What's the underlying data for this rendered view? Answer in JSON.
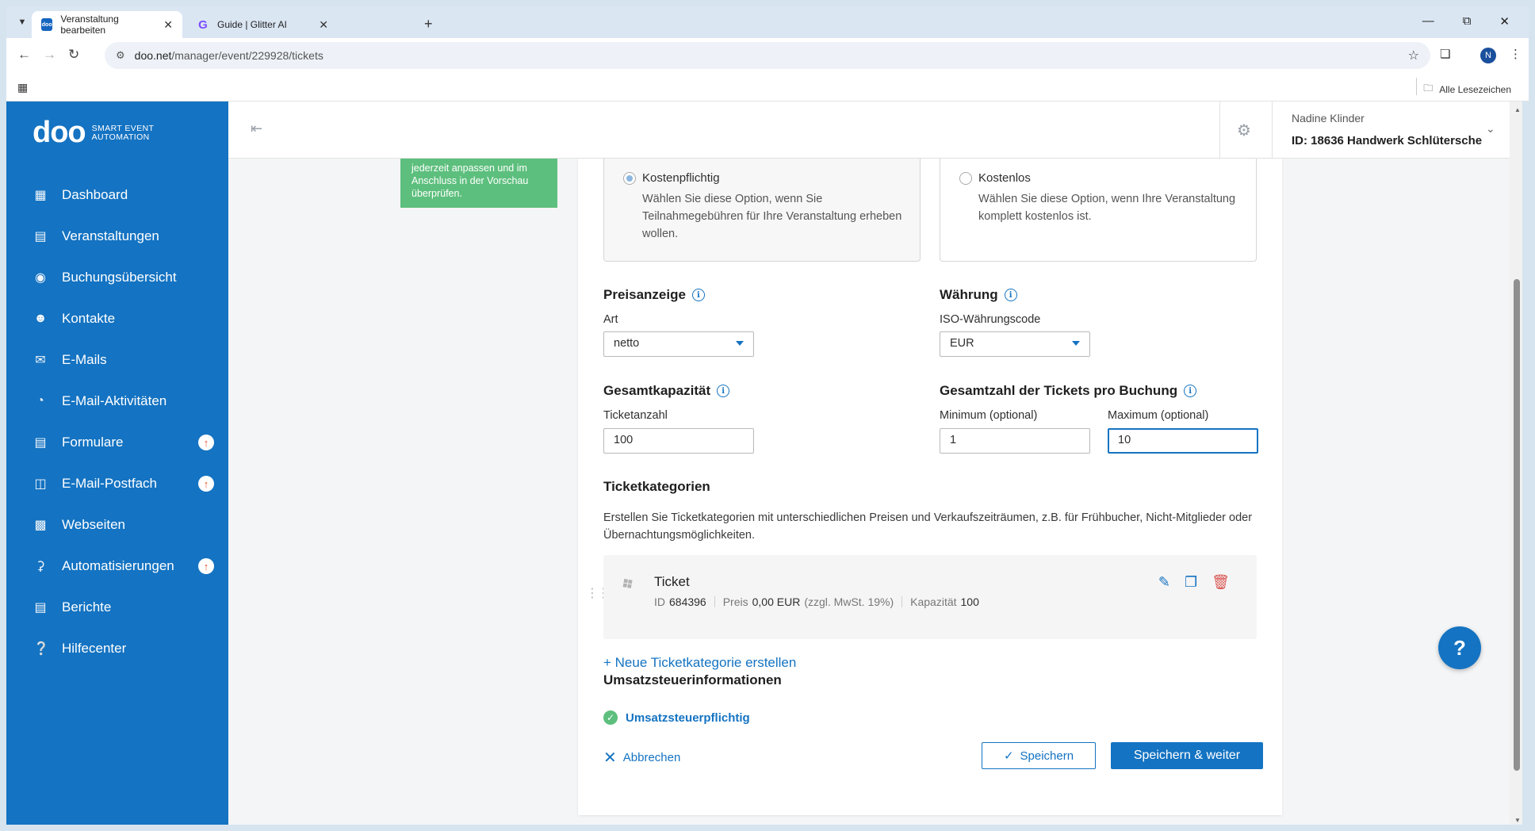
{
  "browser": {
    "tabs": [
      {
        "title": "Veranstaltung bearbeiten",
        "favicon": "doo",
        "active": true
      },
      {
        "title": "Guide | Glitter AI",
        "favicon": "G",
        "active": false
      }
    ],
    "url_host": "doo.net",
    "url_path": "/manager/event/229928/tickets",
    "profile_initial": "N",
    "all_bookmarks": "Alle Lesezeichen"
  },
  "sidebar": {
    "logo": "doo",
    "tagline_line1": "SMART EVENT",
    "tagline_line2": "AUTOMATION",
    "items": [
      {
        "label": "Dashboard",
        "icon": "dashboard-icon",
        "badge": false
      },
      {
        "label": "Veranstaltungen",
        "icon": "calendar-icon",
        "badge": false
      },
      {
        "label": "Buchungsübersicht",
        "icon": "bookings-icon",
        "badge": false
      },
      {
        "label": "Kontakte",
        "icon": "contacts-icon",
        "badge": false
      },
      {
        "label": "E-Mails",
        "icon": "mail-icon",
        "badge": false
      },
      {
        "label": "E-Mail-Aktivitäten",
        "icon": "activity-icon",
        "badge": false
      },
      {
        "label": "Formulare",
        "icon": "form-icon",
        "badge": true
      },
      {
        "label": "E-Mail-Postfach",
        "icon": "inbox-icon",
        "badge": true
      },
      {
        "label": "Webseiten",
        "icon": "website-icon",
        "badge": false
      },
      {
        "label": "Automatisierungen",
        "icon": "automation-icon",
        "badge": true
      },
      {
        "label": "Berichte",
        "icon": "report-icon",
        "badge": false
      },
      {
        "label": "Hilfecenter",
        "icon": "help-icon",
        "badge": false
      }
    ]
  },
  "topbar": {
    "user_name": "Nadine Klinder",
    "user_org": "ID: 18636  Handwerk Schlütersche"
  },
  "hint": {
    "text": "jederzeit anpassen und im Anschluss in der Vorschau überprüfen."
  },
  "pricing": {
    "paid_label": "Kostenpflichtig",
    "paid_desc": "Wählen Sie diese Option, wenn Sie Teilnahmegebühren für Ihre Veranstaltung erheben wollen.",
    "free_label": "Kostenlos",
    "free_desc": "Wählen Sie diese Option, wenn Ihre Veranstaltung komplett kostenlos ist."
  },
  "price_display": {
    "title": "Preisanzeige",
    "field_label": "Art",
    "value": "netto"
  },
  "currency": {
    "title": "Währung",
    "field_label": "ISO-Währungscode",
    "value": "EUR"
  },
  "capacity": {
    "title": "Gesamtkapazität",
    "field_label": "Ticketanzahl",
    "value": "100"
  },
  "tickets_per_booking": {
    "title": "Gesamtzahl der Tickets pro Buchung",
    "min_label": "Minimum (optional)",
    "min_value": "1",
    "max_label": "Maximum (optional)",
    "max_value": "10"
  },
  "ticket_categories": {
    "title": "Ticketkategorien",
    "description": "Erstellen Sie Ticketkategorien mit unterschiedlichen Preisen und Verkaufszeiträumen, z.B. für Frühbucher, Nicht-Mitglieder oder Übernachtungsmöglichkeiten.",
    "items": [
      {
        "name": "Ticket",
        "id_label": "ID",
        "id_value": "684396",
        "price_label": "Preis",
        "price_value": "0,00 EUR",
        "price_note": "(zzgl. MwSt. 19%)",
        "capacity_label": "Kapazität",
        "capacity_value": "100"
      }
    ],
    "new_link": "+ Neue Ticketkategorie erstellen"
  },
  "tax": {
    "title": "Umsatzsteuerinformationen",
    "status": "Umsatzsteuerpflichtig"
  },
  "actions": {
    "cancel": "Abbrechen",
    "save": "Speichern",
    "save_next": "Speichern & weiter"
  },
  "help_fab": "?"
}
